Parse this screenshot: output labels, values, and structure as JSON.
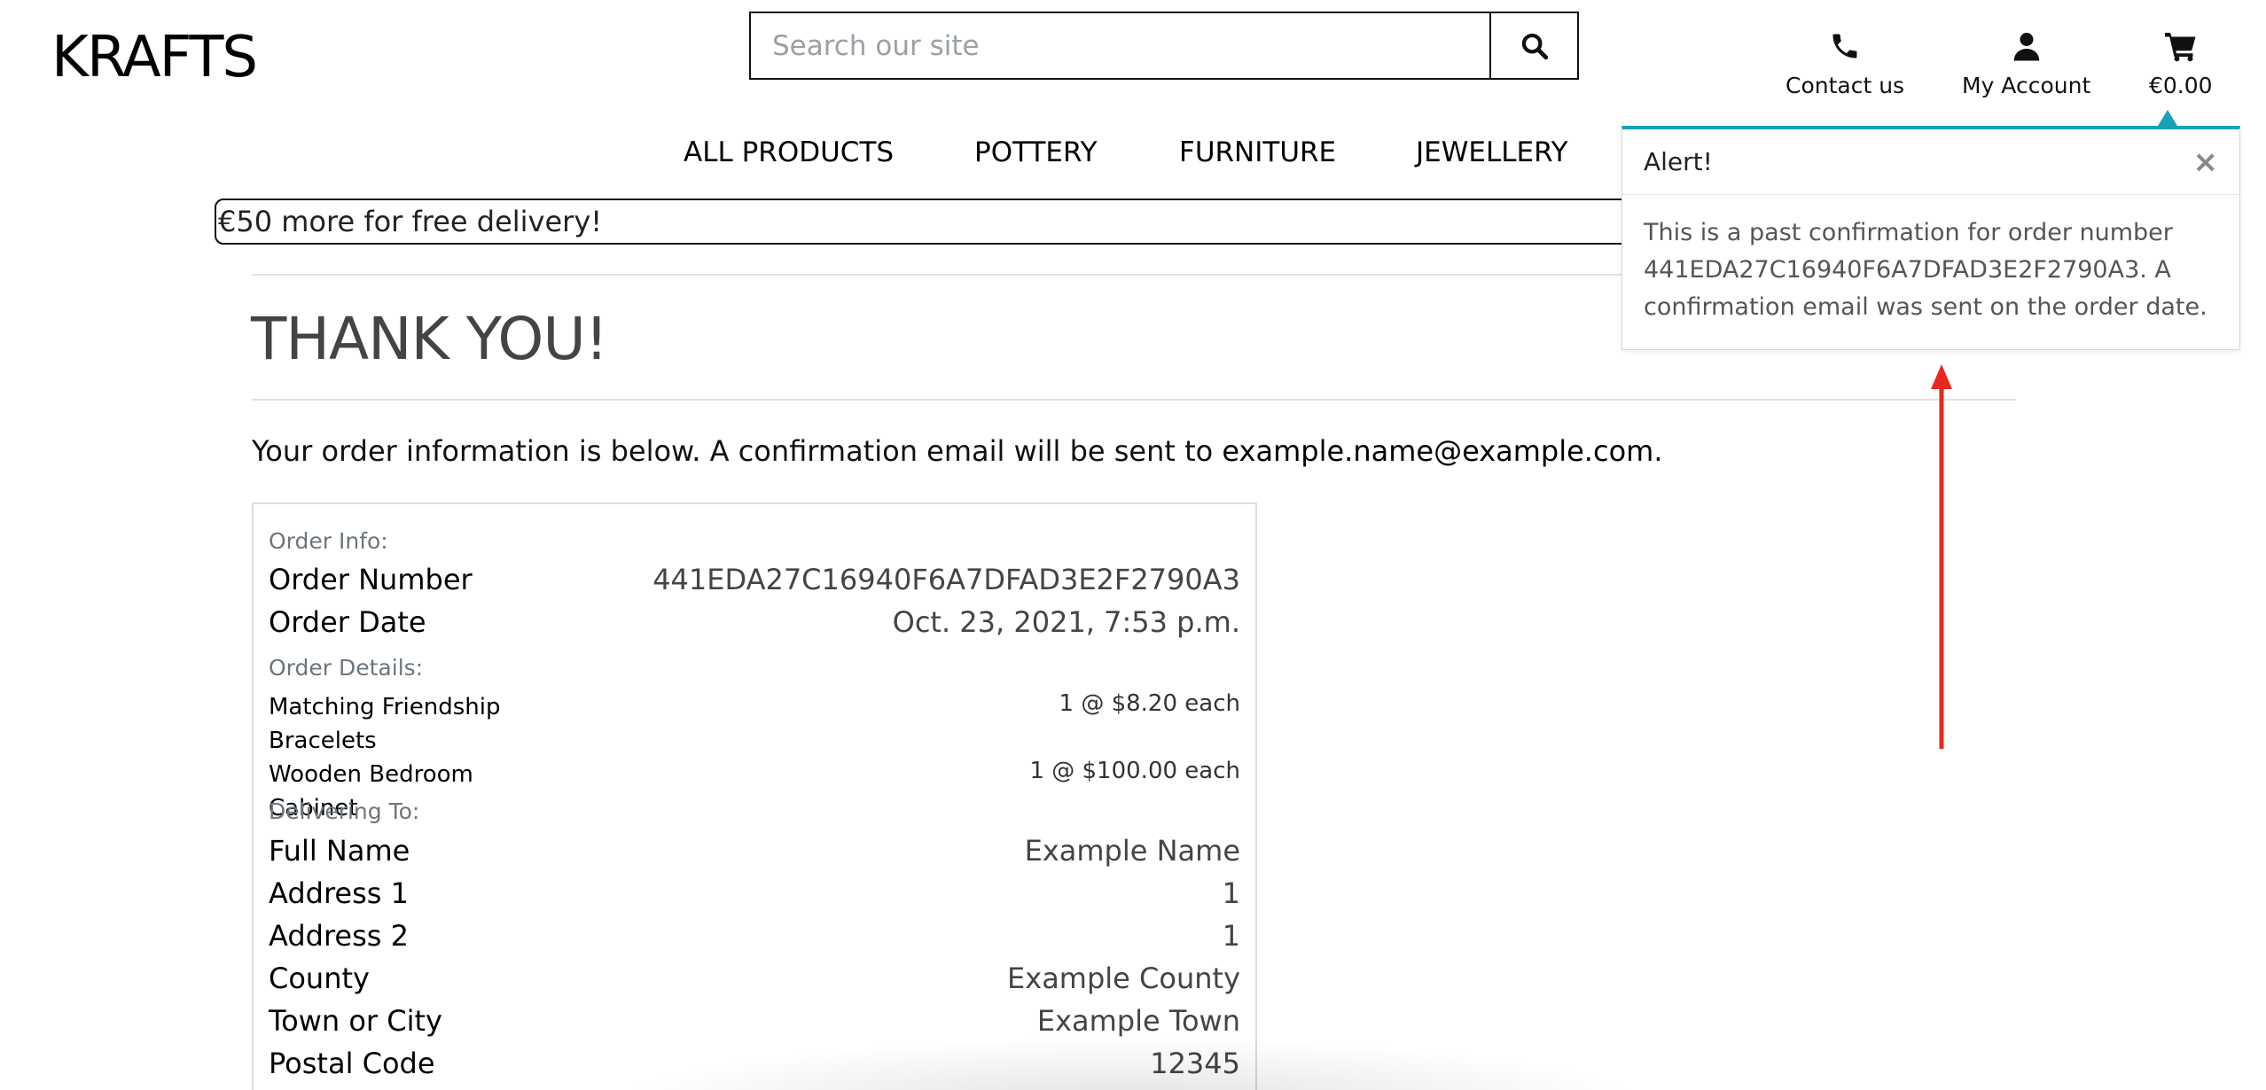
{
  "header": {
    "logo": "KRAFTS",
    "search_placeholder": "Search our site",
    "contact_label": "Contact us",
    "account_label": "My Account",
    "cart_total": "€0.00"
  },
  "nav": {
    "items": [
      "ALL PRODUCTS",
      "POTTERY",
      "FURNITURE",
      "JEWELLERY"
    ]
  },
  "banner": "€50 more for free delivery!",
  "main": {
    "title": "THANK YOU!",
    "info_prefix": "Your order information is below. A confirmation email will be sent to ",
    "email": "example.name@example.com",
    "info_suffix": "."
  },
  "order": {
    "info_heading": "Order Info:",
    "number_label": "Order Number",
    "number_value": "441EDA27C16940F6A7DFAD3E2F2790A3",
    "date_label": "Order Date",
    "date_value": "Oct. 23, 2021, 7:53 p.m.",
    "details_heading": "Order Details:",
    "items": [
      {
        "name": "Matching Friendship Bracelets",
        "qty": "1 @ $8.20 each"
      },
      {
        "name": "Wooden Bedroom Cabinet",
        "qty": "1 @ $100.00 each"
      }
    ],
    "delivery_heading": "Delivering To:",
    "delivery": [
      {
        "label": "Full Name",
        "value": "Example Name"
      },
      {
        "label": "Address 1",
        "value": "1"
      },
      {
        "label": "Address 2",
        "value": "1"
      },
      {
        "label": "County",
        "value": "Example County"
      },
      {
        "label": "Town or City",
        "value": "Example Town"
      },
      {
        "label": "Postal Code",
        "value": "12345"
      }
    ]
  },
  "alert": {
    "title": "Alert!",
    "close": "×",
    "message": "This is a past confirmation for order number 441EDA27C16940F6A7DFAD3E2F2790A3. A confirmation email was sent on the order date.",
    "accent_color": "#17a2b8"
  },
  "annotation": {
    "arrow_color": "#e8281e"
  }
}
